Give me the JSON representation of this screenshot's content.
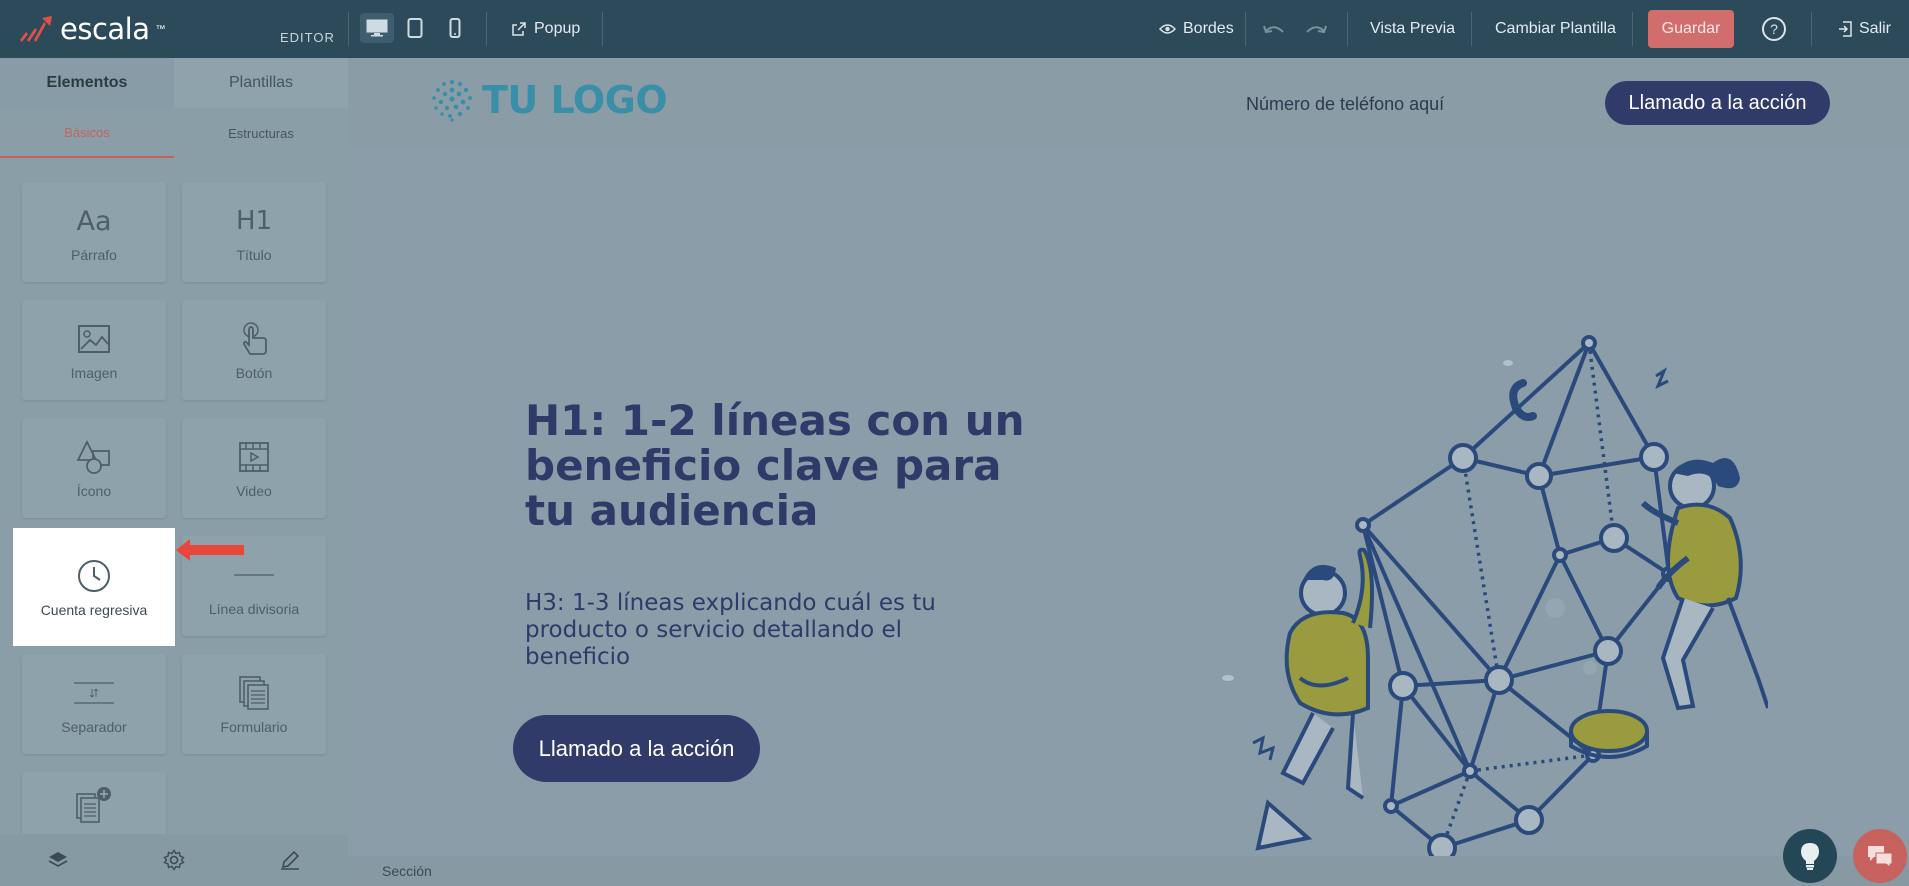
{
  "app": {
    "brand": "escala",
    "brand_tm": "™",
    "editor_label": "EDITOR"
  },
  "toolbar": {
    "popup": "Popup",
    "bordes": "Bordes",
    "vista_previa": "Vista Previa",
    "cambiar_plantilla": "Cambiar Plantilla",
    "guardar": "Guardar",
    "help": "?",
    "salir": "Salir"
  },
  "sidebar": {
    "tabs": [
      "Elementos",
      "Plantillas"
    ],
    "subtabs": [
      "Básicos",
      "Estructuras"
    ],
    "items": [
      {
        "label": "Párrafo",
        "icon": "paragraph-icon"
      },
      {
        "label": "Título",
        "icon": "heading-icon"
      },
      {
        "label": "Imagen",
        "icon": "image-icon"
      },
      {
        "label": "Botón",
        "icon": "button-icon"
      },
      {
        "label": "Ícono",
        "icon": "shapes-icon"
      },
      {
        "label": "Video",
        "icon": "video-icon"
      },
      {
        "label": "Cuenta regresiva",
        "icon": "clock-icon"
      },
      {
        "label": "Línea divisoria",
        "icon": "divider-icon"
      },
      {
        "label": "Separador",
        "icon": "spacer-icon"
      },
      {
        "label": "Formulario",
        "icon": "form-icon"
      }
    ],
    "glyphs": {
      "paragraph": "Aa",
      "heading": "H1"
    }
  },
  "page": {
    "logo": "TU LOGO",
    "phone": "Número de teléfono aquí",
    "cta_top": "Llamado a la acción",
    "h1": "H1: 1-2 líneas con un beneficio clave para tu audiencia",
    "h3": "H3: 1-3 líneas explicando cuál es tu producto o servicio detallando el beneficio",
    "cta_hero": "Llamado a la acción",
    "section_label": "Sección"
  },
  "colors": {
    "topbar": "#2c4a5a",
    "guardar": "#d16d6c",
    "cta": "#313b6a",
    "highlight_arrow": "#e8483b"
  }
}
